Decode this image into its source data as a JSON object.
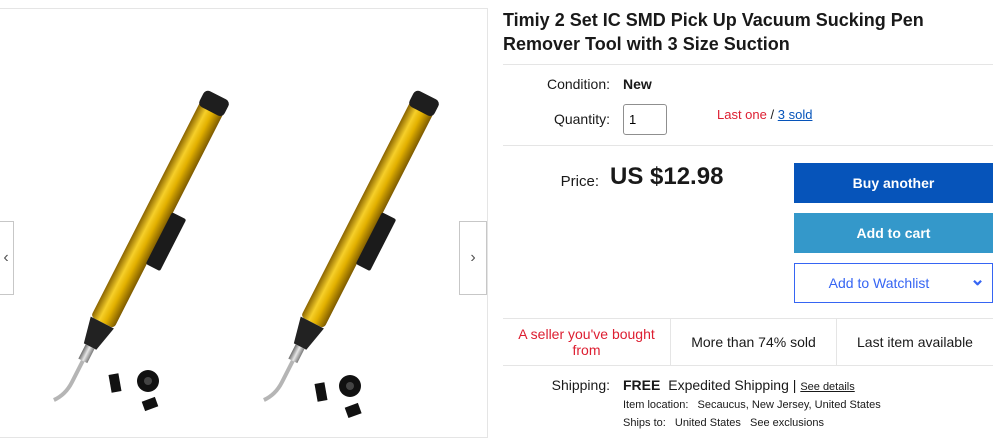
{
  "product": {
    "title": "Timiy 2 Set IC SMD Pick Up Vacuum Sucking Pen Remover Tool with 3 Size Suction"
  },
  "gallery": {
    "prev_icon": "‹",
    "next_icon": "›"
  },
  "condition": {
    "label": "Condition:",
    "value": "New"
  },
  "quantity": {
    "label": "Quantity:",
    "value": "1",
    "last_one": "Last one",
    "separator": "/",
    "sold_link": "3 sold"
  },
  "price": {
    "label": "Price:",
    "value": "US $12.98"
  },
  "buttons": {
    "buy_another": "Buy another",
    "add_to_cart": "Add to cart",
    "add_to_watchlist": "Add to Watchlist",
    "watchlist_chevron": "⌄"
  },
  "badges": {
    "seller": "A seller you've bought from",
    "sold_pct": "More than 74% sold",
    "last_item": "Last item available"
  },
  "shipping": {
    "label": "Shipping:",
    "cost": "FREE",
    "method": "Expedited Shipping",
    "separator": "|",
    "details_link": "See details",
    "location_label": "Item location:",
    "location_value": "Secaucus, New Jersey, United States",
    "ships_to_label": "Ships to:",
    "ships_to_value": "United States",
    "exclusions_link": "See exclusions"
  },
  "colors": {
    "primary_blue": "#0654ba",
    "secondary_blue": "#3498ca",
    "alert_red": "#dd1e31",
    "pen_gold": "#e3b100"
  }
}
